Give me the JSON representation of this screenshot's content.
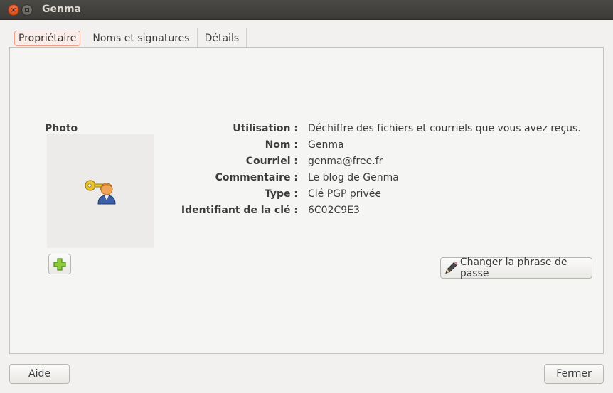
{
  "window": {
    "title": "Genma"
  },
  "tabs": [
    {
      "label": "Propriétaire",
      "active": true
    },
    {
      "label": "Noms et signatures",
      "active": false
    },
    {
      "label": "Détails",
      "active": false
    }
  ],
  "owner": {
    "photo_label": "Photo",
    "fields": [
      {
        "label": "Utilisation :",
        "value": "Déchiffre des fichiers et courriels que vous avez reçus."
      },
      {
        "label": "Nom :",
        "value": "Genma"
      },
      {
        "label": "Courriel :",
        "value": "genma@free.fr"
      },
      {
        "label": "Commentaire :",
        "value": "Le blog de Genma"
      },
      {
        "label": "Type :",
        "value": "Clé PGP privée"
      },
      {
        "label": "Identifiant de la clé :",
        "value": "6C02C9E3"
      }
    ],
    "add_photo_icon": "plus-icon",
    "change_passphrase_label": "Changer la phrase de passe",
    "change_passphrase_icon": "pencil-icon"
  },
  "footer": {
    "help_label": "Aide",
    "close_label": "Fermer"
  }
}
